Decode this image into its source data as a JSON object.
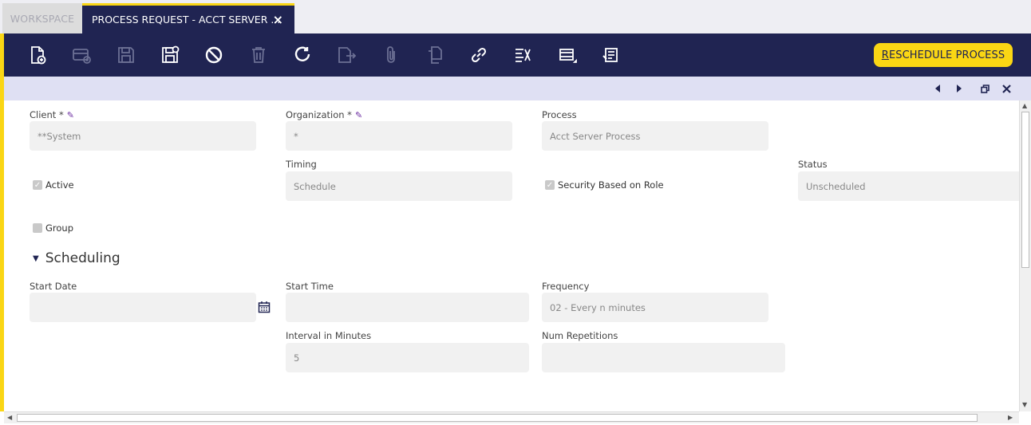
{
  "tabs": {
    "workspace": "WORKSPACE",
    "active": "PROCESS REQUEST - ACCT SERVER ...",
    "close": "×"
  },
  "toolbar": {
    "icons": [
      "new-document-icon",
      "new-row-icon",
      "save-icon",
      "save-close-icon",
      "undo-icon",
      "delete-icon",
      "refresh-icon",
      "export-icon",
      "attach-icon",
      "copy-icon",
      "link-icon",
      "tools-icon",
      "grid-toggle-icon",
      "audit-icon"
    ],
    "reschedule_prefix": "R",
    "reschedule_rest": "ESCHEDULE PROCESS"
  },
  "form": {
    "client_label": "Client *",
    "client_value": "**System",
    "organization_label": "Organization *",
    "organization_value": "*",
    "process_label": "Process",
    "process_value": "Acct Server Process",
    "active_label": "Active",
    "timing_label": "Timing",
    "timing_value": "Schedule",
    "security_label": "Security Based on Role",
    "status_label": "Status",
    "status_value": "Unscheduled",
    "group_label": "Group"
  },
  "scheduling": {
    "title": "Scheduling",
    "start_date_label": "Start Date",
    "start_date_value": "",
    "start_time_label": "Start Time",
    "start_time_value": "",
    "frequency_label": "Frequency",
    "frequency_value": "02 - Every n minutes",
    "interval_label": "Interval in Minutes",
    "interval_value": "5",
    "repetitions_label": "Num Repetitions",
    "repetitions_value": ""
  },
  "colors": {
    "brand_dark": "#202452",
    "accent": "#fad614",
    "nav": "#dfe0f3"
  }
}
